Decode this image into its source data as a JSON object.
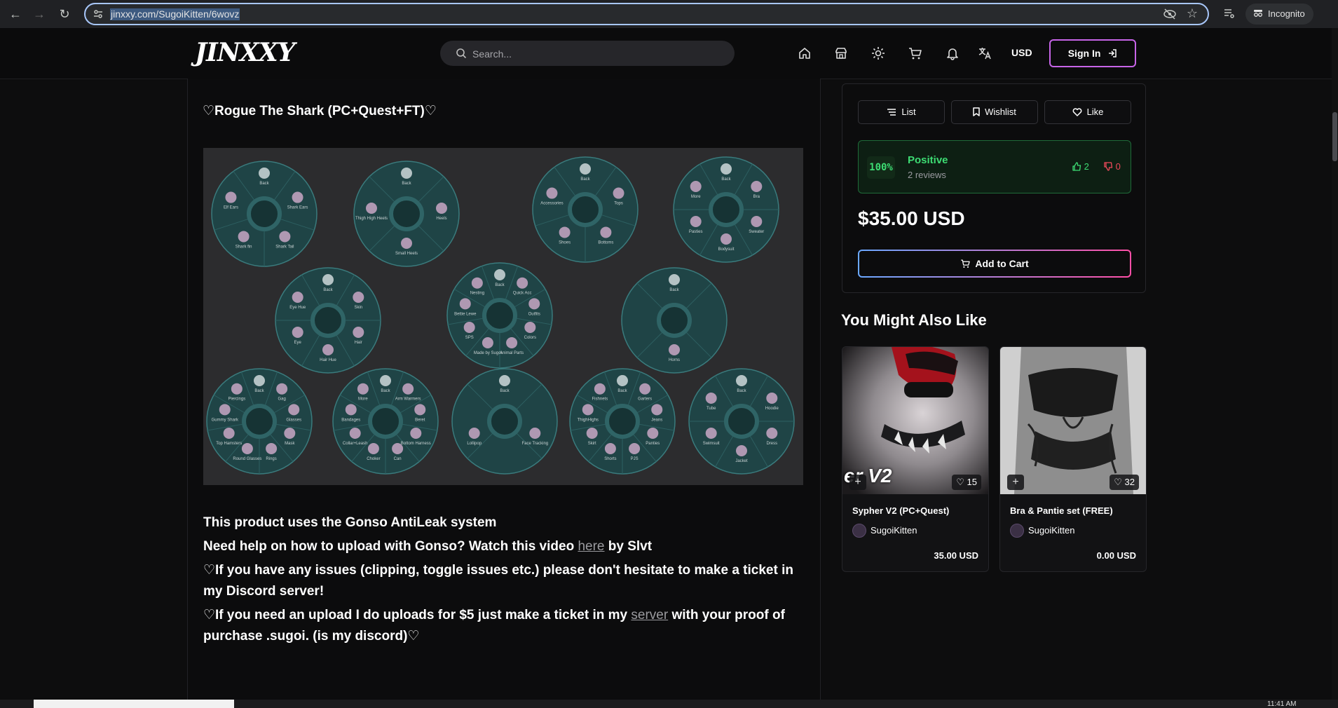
{
  "browser": {
    "url": "jinxxy.com/SugoiKitten/6wovz",
    "mode_label": "Incognito"
  },
  "header": {
    "logo": "JINXXY",
    "search_placeholder": "Search...",
    "currency": "USD",
    "sign_in_label": "Sign In"
  },
  "product": {
    "title": "♡Rogue The Shark (PC+Quest+FT)♡",
    "description": {
      "line1": "This product uses the Gonso AntiLeak system",
      "line2_pre": "Need help on how to upload with Gonso? Watch this video ",
      "line2_link": "here",
      "line2_post": " by Slvt",
      "line3": "♡If you have any issues (clipping, toggle issues etc.) please don't hesitate to make a ticket in my Discord server!",
      "line4_pre": "♡If you need an upload I do uploads for $5 just make a ticket in my ",
      "line4_link": "server",
      "line4_post": " with your proof of purchase .sugoi. (is my discord)♡"
    },
    "menu_wheels": [
      {
        "labels": [
          "Back",
          "Shark Ears",
          "Shark Tail",
          "Shark fin",
          "Elf Ears"
        ]
      },
      {
        "labels": [
          "Back",
          "Heels",
          "Small Heels",
          "Thigh High Heels"
        ]
      },
      {
        "labels": [
          "Back",
          "Tops",
          "Bottoms",
          "Shoes",
          "Accessories"
        ]
      },
      {
        "labels": [
          "Back",
          "Bra",
          "Sweater",
          "Bodysuit",
          "Pasties",
          "More"
        ]
      },
      {
        "labels": [
          "Back",
          "Skin",
          "Hair",
          "Hair Hue",
          "Eye",
          "Eye Hue"
        ]
      },
      {
        "labels": [
          "Back",
          "Quick Acc",
          "Outfits",
          "Colors",
          "Animal Parts",
          "Made by Sugoi",
          "SPS",
          "Bettie Lewe",
          "Nesting"
        ]
      },
      {
        "labels": [
          "Back",
          "Horns"
        ]
      },
      {
        "labels": [
          "Back",
          "Gag",
          "Glasses",
          "Mask",
          "Rings",
          "Round Glasses",
          "Top Hamsters",
          "Gummy Shark",
          "Piercings"
        ]
      },
      {
        "labels": [
          "Back",
          "Arm Warmers",
          "Beret",
          "Bottom Harness",
          "Can",
          "Choker",
          "Collar+Leash",
          "Bandages",
          "More"
        ]
      },
      {
        "labels": [
          "Back",
          "Face Tracking",
          "Lollipop"
        ]
      },
      {
        "labels": [
          "Back",
          "Garters",
          "Jeans",
          "Panties",
          "PJS",
          "Shorts",
          "Skirt",
          "ThighHighs",
          "Fishnets"
        ]
      },
      {
        "labels": [
          "Back",
          "Hoodie",
          "Dress",
          "Jacket",
          "Swimsuit",
          "Tube"
        ]
      }
    ]
  },
  "sidebar": {
    "list_label": "List",
    "wishlist_label": "Wishlist",
    "like_label": "Like",
    "rating_percent": "100%",
    "rating_text": "Positive",
    "review_count": "2 reviews",
    "thumbs_up": "2",
    "thumbs_down": "0",
    "price": "$35.00 USD",
    "add_to_cart_label": "Add to Cart"
  },
  "recommendations": {
    "title": "You Might Also Like",
    "items": [
      {
        "name": "Sypher V2 (PC+Quest)",
        "author": "SugoiKitten",
        "price": "35.00 USD",
        "likes": "15",
        "overlay_text": "er V2"
      },
      {
        "name": "Bra & Pantie set (FREE)",
        "author": "SugoiKitten",
        "price": "0.00 USD",
        "likes": "32"
      }
    ]
  },
  "taskbar": {
    "clock": "11:41 AM"
  },
  "colors": {
    "accent_green": "#3ddc73",
    "accent_red": "#ef4a5b",
    "signin_border": "#c764e8",
    "background": "#0d0d0e"
  }
}
